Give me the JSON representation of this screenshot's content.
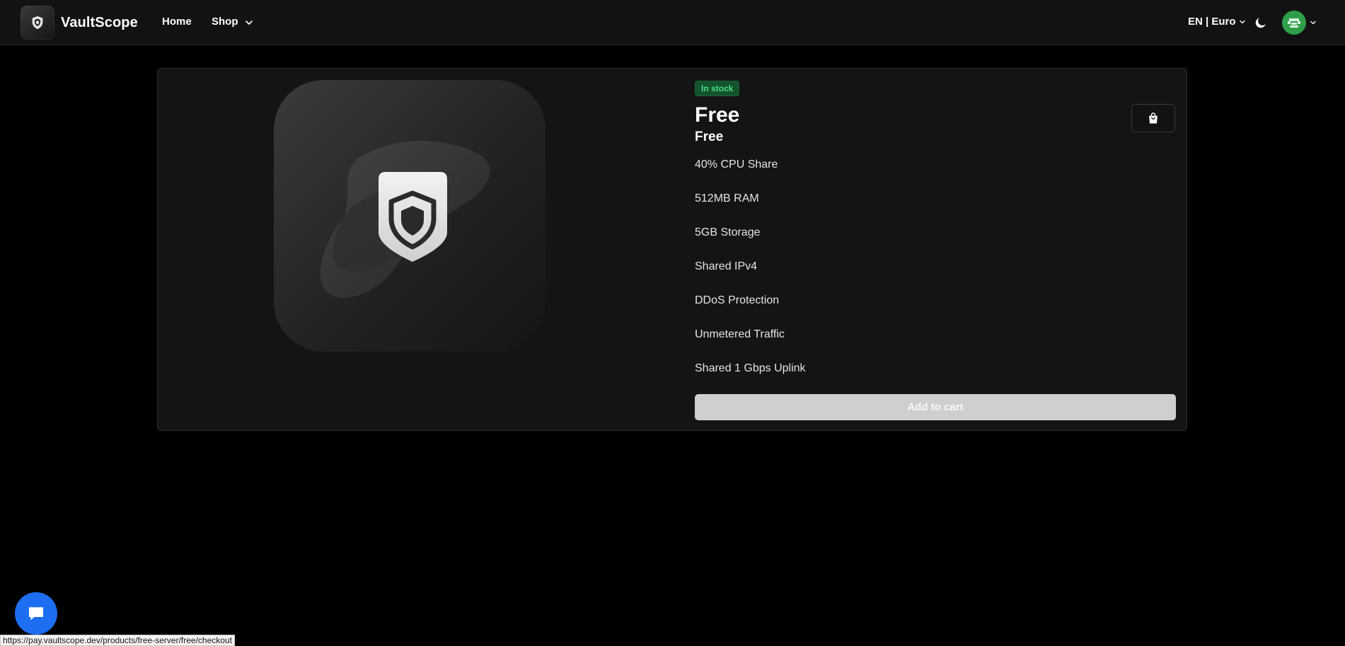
{
  "brand": {
    "name": "VaultScope",
    "logo_icon": "shield-logo-icon"
  },
  "nav": {
    "home": "Home",
    "shop": "Shop",
    "language_currency": "EN | Euro"
  },
  "product": {
    "stock_badge": "In stock",
    "name": "Free",
    "price": "Free",
    "features": [
      "40% CPU Share",
      "512MB RAM",
      "5GB Storage",
      "Shared IPv4",
      "DDoS Protection",
      "Unmetered Traffic",
      "Shared 1 Gbps Uplink"
    ],
    "add_to_cart": "Add to cart"
  },
  "status_bar": {
    "url": "https://pay.vaultscope.dev/products/free-server/free/checkout"
  },
  "colors": {
    "background": "#000000",
    "navbar": "#121212",
    "card": "#141414",
    "badge_bg": "#14532d",
    "badge_text": "#4ade80",
    "chat_bubble": "#1d6ef0",
    "avatar": "#2f9e4a"
  }
}
